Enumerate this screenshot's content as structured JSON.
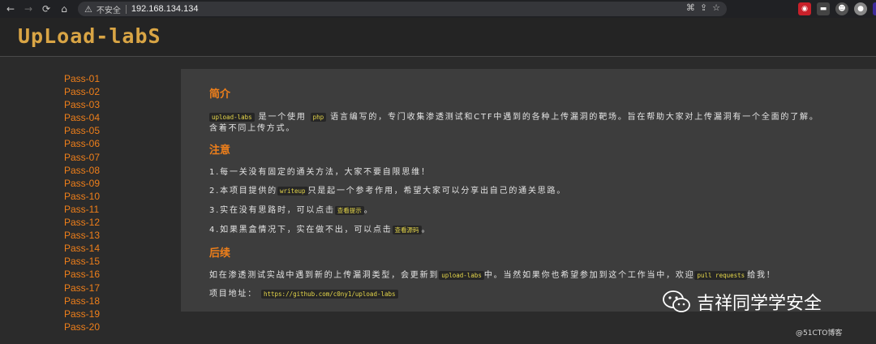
{
  "browser": {
    "insecure_label": "不安全",
    "url": "192.168.134.134"
  },
  "logo": {
    "text": "UpLoad-labS"
  },
  "sidebar": {
    "items": [
      "Pass-01",
      "Pass-02",
      "Pass-03",
      "Pass-04",
      "Pass-05",
      "Pass-06",
      "Pass-07",
      "Pass-08",
      "Pass-09",
      "Pass-10",
      "Pass-11",
      "Pass-12",
      "Pass-13",
      "Pass-14",
      "Pass-15",
      "Pass-16",
      "Pass-17",
      "Pass-18",
      "Pass-19",
      "Pass-20"
    ]
  },
  "intro": {
    "title": "简介",
    "code1": "upload-labs",
    "t1": "是一个使用",
    "code2": "php",
    "t2": "语言编写的，专门收集渗透测试和CTF中遇到的各种上传漏洞的靶场。旨在帮助大家对上传漏洞有一个全面的了解。",
    "t3": "含着不同上传方式。"
  },
  "notes": {
    "title": "注意",
    "n1": "1.每一关没有固定的通关方法，大家不要自限思维！",
    "n2a": "2.本项目提供的",
    "n2code": "writeup",
    "n2b": "只是起一个参考作用，希望大家可以分享出自己的通关思路。",
    "n3a": "3.实在没有思路时，可以点击",
    "n3link": "查看提示",
    "n3b": "。",
    "n4a": "4.如果黑盒情况下，实在做不出，可以点击",
    "n4link": "查看源码",
    "n4b": "。"
  },
  "followup": {
    "title": "后续",
    "f1a": "如在渗透测试实战中遇到新的上传漏洞类型，会更新到",
    "f1code": "upload-labs",
    "f1b": "中。当然如果你也希望参加到这个工作当中，欢迎",
    "f1code2": "pull requests",
    "f1c": "给我！",
    "repo_label": "项目地址：",
    "repo_url": "https://github.com/c0ny1/upload-labs"
  },
  "watermark": {
    "main": "吉祥同学学安全",
    "small": "@51CTO博客"
  }
}
